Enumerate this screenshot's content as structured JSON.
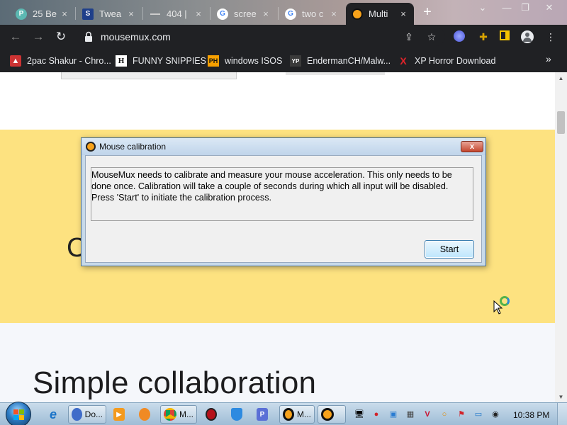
{
  "browser": {
    "tabs": [
      {
        "label": "25 Be",
        "close": "×",
        "favicon": "P",
        "favicon_color": "#5cb8b2"
      },
      {
        "label": "Twea",
        "close": "×",
        "favicon": "S",
        "favicon_color": "#1f3f8a"
      },
      {
        "label": "404 |",
        "close": "×",
        "favicon": "",
        "favicon_color": "#7d7d7d"
      },
      {
        "label": "scree",
        "close": "×",
        "favicon": "G",
        "favicon_color": "#ffffff"
      },
      {
        "label": "two c",
        "close": "×",
        "favicon": "G",
        "favicon_color": "#ffffff"
      },
      {
        "label": "Multi",
        "close": "×",
        "favicon": "",
        "favicon_color": "#f7a21a"
      }
    ],
    "new_tab": "+",
    "window_controls": {
      "dropdown": "⌄",
      "minimize": "—",
      "restore": "❐",
      "close": "✕"
    },
    "nav": {
      "back": "←",
      "forward": "→",
      "reload": "↻"
    },
    "url": "mousemux.com",
    "bookmarks": [
      {
        "label": "2pac Shakur - Chro...",
        "icon": "bag-icon",
        "icon_text": "▲"
      },
      {
        "label": "FUNNY SNIPPIES",
        "icon": "h-logo-icon",
        "icon_text": "H"
      },
      {
        "label": "windows ISOS",
        "icon": "ph-logo-icon",
        "icon_text": "PH"
      },
      {
        "label": "EndermanCH/Malw...",
        "icon": "yp-logo-icon",
        "icon_text": "YP"
      },
      {
        "label": "XP Horror Download",
        "icon": "x-logo-icon",
        "icon_text": "X"
      }
    ],
    "bookmarks_more": "»"
  },
  "page": {
    "clipped_heading": "C",
    "section_heading": "Simple collaboration"
  },
  "dialog": {
    "title": "Mouse calibration",
    "close_label": "x",
    "message": "MouseMux needs to calibrate and measure your mouse acceleration. This only needs to be done once. Calibration will take a couple of seconds during which all input will be disabled. Press 'Start' to initiate the calibration process.",
    "start_label": "Start"
  },
  "taskbar": {
    "buttons": [
      {
        "label": "",
        "name": "ie-icon"
      },
      {
        "label": "Do...",
        "name": "doc-app-button"
      },
      {
        "label": "",
        "name": "media-player-icon"
      },
      {
        "label": "",
        "name": "uc-icon"
      },
      {
        "label": "M...",
        "name": "chrome-button"
      },
      {
        "label": "",
        "name": "red-app-icon"
      },
      {
        "label": "",
        "name": "shield-app-icon"
      },
      {
        "label": "",
        "name": "p-app-icon"
      },
      {
        "label": "M...",
        "name": "mousemux-button"
      },
      {
        "label": "",
        "name": "mousemux-small-icon"
      }
    ],
    "clock": "10:38 PM"
  },
  "colors": {
    "page_yellow": "#fde280",
    "dialog_frame": "#c8daea",
    "chrome_dark": "#202124"
  }
}
